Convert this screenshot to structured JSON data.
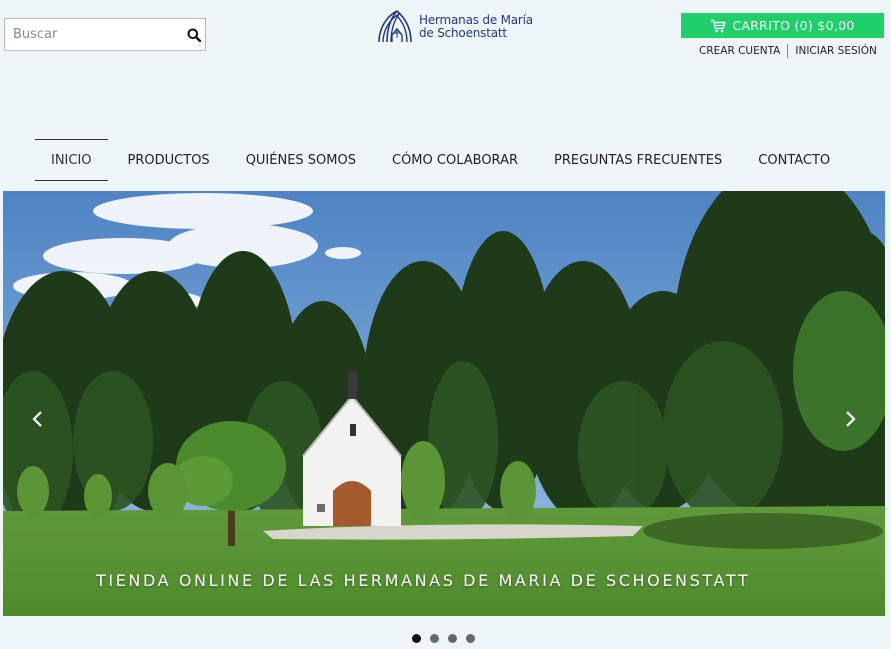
{
  "search": {
    "placeholder": "Buscar",
    "icon": "search-icon"
  },
  "logo": {
    "line1": "Hermanas de María",
    "line2": "de Schoenstatt",
    "color": "#243a78"
  },
  "cart": {
    "label": "CARRITO (0) $0,00",
    "color": "#1fd06a",
    "icon": "cart-icon"
  },
  "account": {
    "create": "CREAR CUENTA",
    "login": "INICIAR SESIÓN"
  },
  "nav": {
    "items": [
      {
        "label": "INICIO",
        "active": true
      },
      {
        "label": "PRODUCTOS"
      },
      {
        "label": "QUIÉNES SOMOS"
      },
      {
        "label": "CÓMO COLABORAR"
      },
      {
        "label": "PREGUNTAS FRECUENTES"
      },
      {
        "label": "CONTACTO"
      }
    ]
  },
  "slider": {
    "caption": "TIENDA ONLINE DE LAS HERMANAS DE MARIA DE SCHOENSTATT",
    "slide_count": 4,
    "current_slide": 1,
    "prev_icon": "chevron-left-icon",
    "next_icon": "chevron-right-icon"
  }
}
